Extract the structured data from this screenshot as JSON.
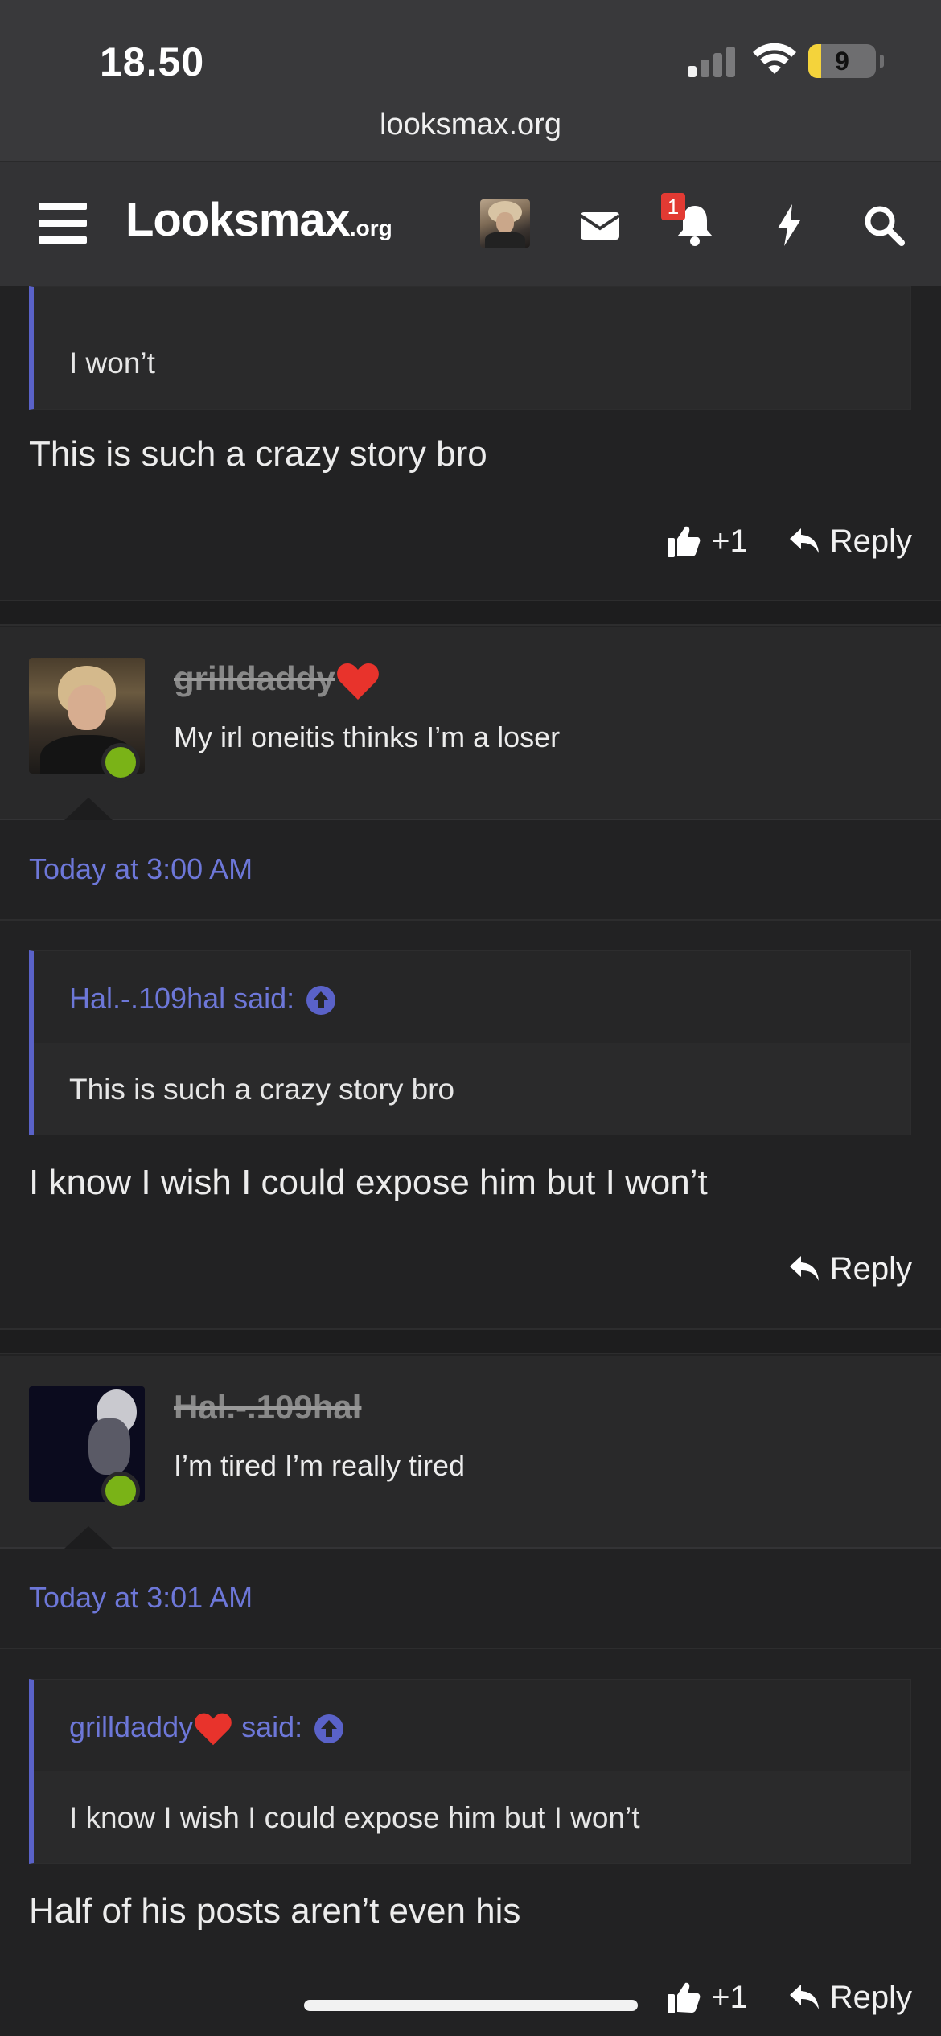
{
  "status_bar": {
    "time": "18.50",
    "battery": "9"
  },
  "browser": {
    "url": "looksmax.org"
  },
  "header": {
    "logo_main": "Looksmax",
    "logo_sub": ".org",
    "notification_count": "1",
    "icons": [
      "menu-icon",
      "avatar",
      "envelope-icon",
      "bell-icon",
      "bolt-icon",
      "search-icon"
    ]
  },
  "top_post": {
    "quote_text": "I won’t",
    "body": "This is such a crazy story bro",
    "like_count": "+1",
    "reply_label": "Reply"
  },
  "posts": [
    {
      "username": "grilldaddy",
      "user_title": "My irl oneitis thinks I’m a loser",
      "timestamp": "Today at 3:00 AM",
      "quote_author": "Hal.-.109hal said:",
      "quote_text": "This is such a crazy story bro",
      "body": "I know I wish I could expose him but I won’t",
      "reply_label": "Reply"
    },
    {
      "username": "Hal.-.109hal",
      "user_title": "I’m tired I’m really tired",
      "timestamp": "Today at 3:01 AM",
      "quote_author": "grilldaddy",
      "quote_said": " said:",
      "quote_text": "I know I wish I could expose him but I won’t",
      "body": "Half of his posts aren’t even his",
      "like_count": "+1",
      "reply_label": "Reply"
    }
  ],
  "colors": {
    "accent": "#6d77d8",
    "online": "#7ab317",
    "background": "#222223",
    "badge": "#e23a33"
  }
}
